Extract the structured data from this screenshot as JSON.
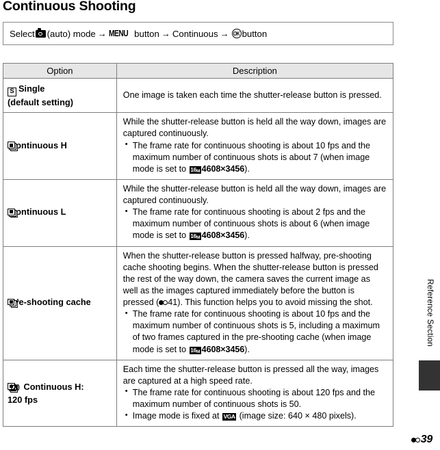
{
  "page": {
    "title": "Continuous Shooting",
    "side_label": "Reference Section",
    "footer_page": "39",
    "footer_icon": "reference-section-mark"
  },
  "path": {
    "prefix": "Select",
    "camera_icon": "camera-auto-mode-icon",
    "mode_text": "(auto) mode",
    "arrow": "→",
    "menu_icon_label": "MENU",
    "menu_text": "button",
    "step_continuous": "Continuous",
    "ok_icon_label": "OK",
    "ok_text": "button"
  },
  "table": {
    "headers": [
      "Option",
      "Description"
    ],
    "rows": [
      {
        "icon": "single-shot-icon",
        "icon_label": "S",
        "option_line1": "Single",
        "option_line2": "(default setting)",
        "intro": "One image is taken each time the shutter-release button is pressed.",
        "bullets": []
      },
      {
        "icon": "continuous-stack-icon",
        "option_line1": "Continuous H",
        "option_line2": "",
        "intro": "While the shutter-release button is held all the way down, images are captured continuously.",
        "bullets": [
          {
            "pre": "The frame rate for continuous shooting is about 10 fps and the maximum number of continuous shots is about 7 (when image mode is set to ",
            "chip": "16",
            "chip_sub": "M",
            "size": "4608×3456",
            "post": ")."
          }
        ]
      },
      {
        "icon": "continuous-stack-icon",
        "option_line1": "Continuous L",
        "option_line2": "",
        "intro": "While the shutter-release button is held all the way down, images are captured continuously.",
        "bullets": [
          {
            "pre": "The frame rate for continuous shooting is about 2 fps and the maximum number of continuous shots is about 6 (when image mode is set to ",
            "chip": "16",
            "chip_sub": "M",
            "size": "4608×3456",
            "post": ")."
          }
        ]
      },
      {
        "icon": "pre-shooting-cache-icon",
        "option_line1": "Pre-shooting cache",
        "option_line2": "",
        "intro_a": "When the shutter-release button is pressed halfway, pre-shooting cache shooting begins. When the shutter-release button is pressed the rest of the way down, the camera saves the current image as well as the images captured immediately before the button is pressed (",
        "intro_ref": "41",
        "intro_b": "). This function helps you to avoid missing the shot.",
        "bullets": [
          {
            "pre": "The frame rate for continuous shooting is about 10 fps and the maximum number of continuous shots is 5, including a maximum of two frames captured in the pre-shooting cache (when image mode is set to ",
            "chip": "16",
            "chip_sub": "M",
            "size": "4608×3456",
            "post": ")."
          }
        ]
      },
      {
        "icon": "continuous-120fps-icon",
        "icon_number": "120",
        "option_line1": "Continuous H:",
        "option_line2": "120 fps",
        "intro": "Each time the shutter-release button is pressed all the way, images are captured at a high speed rate.",
        "bullets": [
          {
            "pre": "The frame rate for continuous shooting is about 120 fps and the maximum number of continuous shots is 50.",
            "chip": "",
            "size": "",
            "post": ""
          },
          {
            "pre": "Image mode is fixed at ",
            "chip": "VGA",
            "chip_sub": "",
            "size": "",
            "post": " (image size: 640 × 480 pixels)."
          }
        ]
      }
    ]
  }
}
